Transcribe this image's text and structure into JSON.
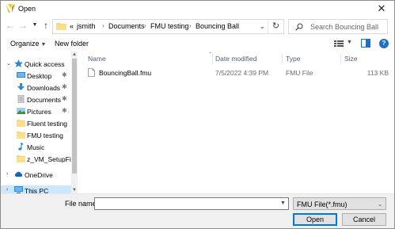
{
  "window": {
    "title": "Open"
  },
  "address": {
    "overflow": "«",
    "crumbs": [
      "jsmith",
      "Documents",
      "FMU testing",
      "Bouncing Ball"
    ]
  },
  "search": {
    "placeholder": "Search Bouncing Ball"
  },
  "toolbar": {
    "organize": "Organize",
    "new_folder": "New folder"
  },
  "sidebar": {
    "items": [
      {
        "label": "Quick access",
        "icon": "star-icon"
      },
      {
        "label": "Desktop",
        "icon": "desktop-icon",
        "pinned": true
      },
      {
        "label": "Downloads",
        "icon": "download-icon",
        "pinned": true
      },
      {
        "label": "Documents",
        "icon": "documents-icon",
        "pinned": true
      },
      {
        "label": "Pictures",
        "icon": "pictures-icon",
        "pinned": true
      },
      {
        "label": "Fluent testing",
        "icon": "folder-icon"
      },
      {
        "label": "FMU testing",
        "icon": "folder-icon"
      },
      {
        "label": "Music",
        "icon": "music-icon"
      },
      {
        "label": "z_VM_SetupFiles",
        "icon": "folder-icon"
      },
      {
        "label": "OneDrive",
        "icon": "cloud-icon"
      },
      {
        "label": "This PC",
        "icon": "computer-icon"
      }
    ]
  },
  "columns": {
    "name": "Name",
    "date": "Date modified",
    "type": "Type",
    "size": "Size"
  },
  "files": [
    {
      "name": "BouncingBall.fmu",
      "date": "7/5/2022 4:39 PM",
      "type": "FMU File",
      "size": "113 KB"
    }
  ],
  "footer": {
    "filename_label": "File name:",
    "filename_value": "",
    "filetype": "FMU File(*.fmu)",
    "open": "Open",
    "cancel": "Cancel"
  },
  "colors": {
    "accent": "#0078d7",
    "folder": "#f8d775",
    "selection": "#cce8ff"
  }
}
